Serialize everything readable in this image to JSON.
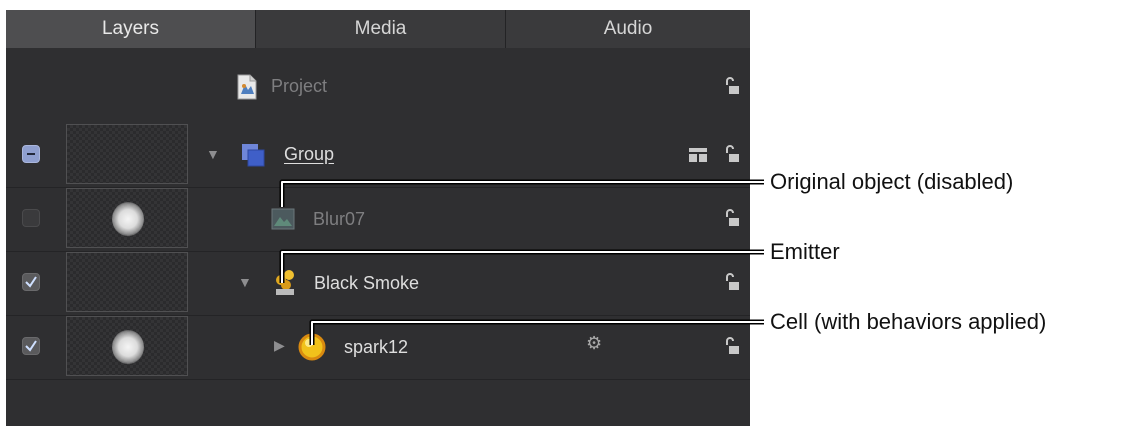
{
  "tabs": [
    {
      "label": "Layers",
      "active": true
    },
    {
      "label": "Media",
      "active": false
    },
    {
      "label": "Audio",
      "active": false
    }
  ],
  "project": {
    "label": "Project",
    "icon": "project-file-icon"
  },
  "rows": [
    {
      "name": "Group",
      "checkbox": "mixed",
      "thumbnail": "empty",
      "expanded": true,
      "icon": "group-icon"
    },
    {
      "name": "Blur07",
      "checkbox": "unchecked",
      "thumbnail": "blur-blob",
      "disabled": true,
      "icon": "image-icon"
    },
    {
      "name": "Black Smoke",
      "checkbox": "checked",
      "thumbnail": "empty",
      "expanded": true,
      "icon": "emitter-icon"
    },
    {
      "name": "spark12",
      "checkbox": "checked",
      "thumbnail": "blur-blob",
      "expanded": false,
      "icon": "cell-icon",
      "has_behaviors": true
    }
  ],
  "callouts": {
    "original": "Original object (disabled)",
    "emitter": "Emitter",
    "cell": "Cell (with behaviors applied)"
  },
  "colors": {
    "panel_bg": "#2f2f31",
    "tab_active": "#4e4e50",
    "callout_line": "#ffffff",
    "callout_outline": "#000000"
  }
}
